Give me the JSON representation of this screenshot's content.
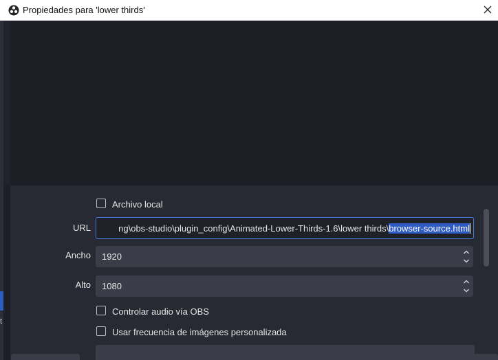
{
  "window": {
    "title": "Propiedades para 'lower thirds'",
    "icon": "obs-logo-icon",
    "close_icon": "close-icon"
  },
  "underlying": {
    "fragment_text": "t"
  },
  "properties": {
    "local_file": {
      "label": "Archivo local",
      "checked": false
    },
    "url": {
      "label": "URL",
      "value_prefix": "ng\\obs-studio\\plugin_config\\Animated-Lower-Thirds-1.6\\lower thirds\\",
      "value_selected": "browser-source.html"
    },
    "width": {
      "label": "Ancho",
      "value": "1920"
    },
    "height": {
      "label": "Alto",
      "value": "1080"
    },
    "control_audio": {
      "label": "Controlar audio vía OBS",
      "checked": false
    },
    "custom_fps": {
      "label": "Usar frecuencia de imágenes personalizada",
      "checked": false
    }
  },
  "colors": {
    "accent": "#4d7fd8",
    "selection": "#2f5bc5",
    "panel": "#272a33",
    "field": "#3a3d47"
  }
}
